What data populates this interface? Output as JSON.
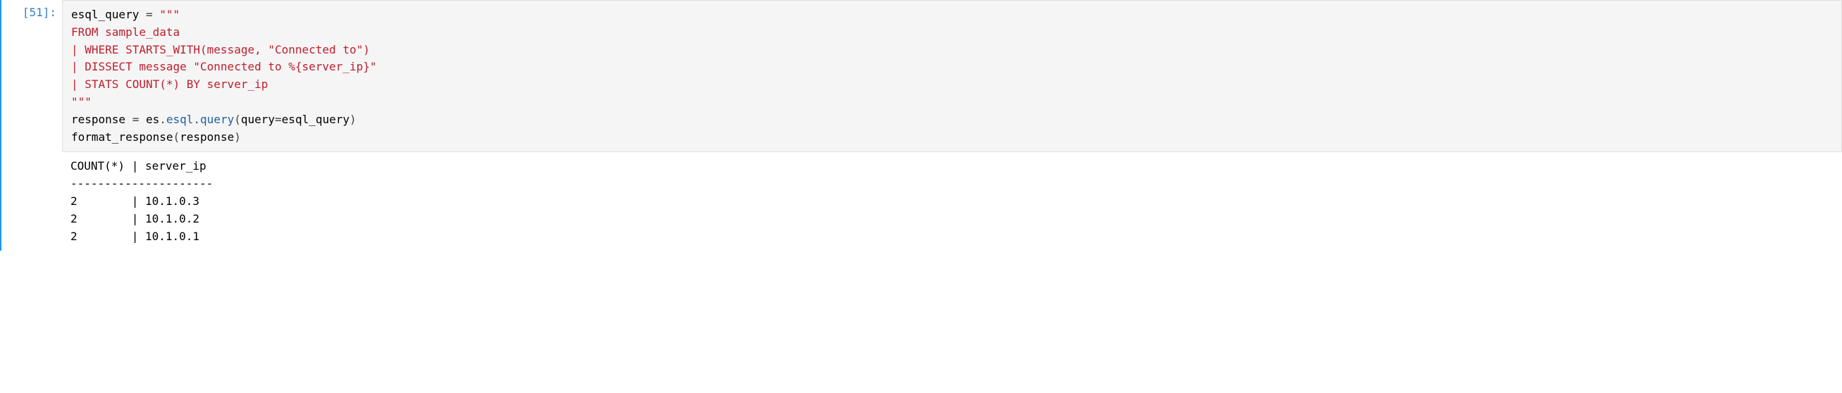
{
  "cell": {
    "prompt_number": 51,
    "prompt_label": "[51]:",
    "code": {
      "line1_var": "esql_query",
      "line1_op": " = ",
      "line1_str_open": "\"\"\"",
      "line2_str": "FROM sample_data",
      "line3_str": "| WHERE STARTS_WITH(message, \"Connected to\")",
      "line4_str": "| DISSECT message \"Connected to %{server_ip}\"",
      "line5_str": "| STATS COUNT(*) BY server_ip",
      "line6_str_close": "\"\"\"",
      "line7_var": "response",
      "line7_op": " = ",
      "line7_obj": "es",
      "line7_dot1": ".",
      "line7_attr1": "esql",
      "line7_dot2": ".",
      "line7_attr2": "query",
      "line7_paren_open": "(",
      "line7_kw": "query",
      "line7_eq": "=",
      "line7_arg": "esql_query",
      "line7_paren_close": ")",
      "line8_fn": "format_response",
      "line8_paren_open": "(",
      "line8_arg": "response",
      "line8_paren_close": ")"
    },
    "output": {
      "header": "COUNT(*) | server_ip",
      "divider": "---------------------",
      "rows": [
        "2        | 10.1.0.3",
        "2        | 10.1.0.2",
        "2        | 10.1.0.1"
      ]
    },
    "toolbar": {
      "duplicate": "duplicate-icon",
      "move_up": "arrow-up-icon",
      "move_down": "arrow-down-icon",
      "insert_above": "insert-above-icon",
      "insert_below": "insert-below-icon",
      "delete": "trash-icon"
    }
  },
  "chart_data": {
    "type": "table",
    "title": "",
    "columns": [
      "COUNT(*)",
      "server_ip"
    ],
    "rows": [
      {
        "COUNT(*)": 2,
        "server_ip": "10.1.0.3"
      },
      {
        "COUNT(*)": 2,
        "server_ip": "10.1.0.2"
      },
      {
        "COUNT(*)": 2,
        "server_ip": "10.1.0.1"
      }
    ]
  }
}
